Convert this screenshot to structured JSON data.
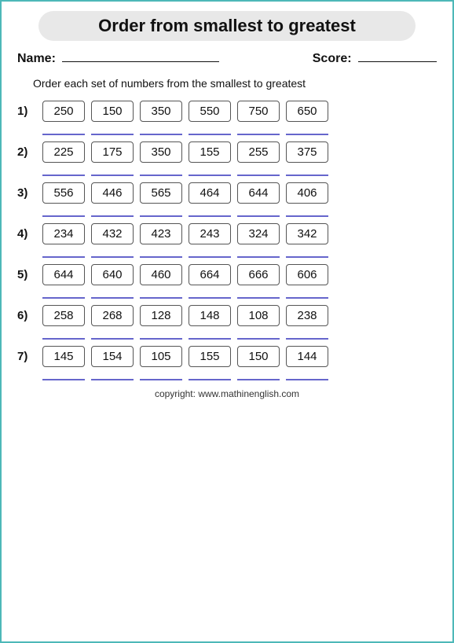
{
  "title": "Order from smallest to greatest",
  "name_label": "Name:",
  "score_label": "Score:",
  "instructions": "Order each set of numbers from the smallest to greatest",
  "problems": [
    {
      "num": "1)",
      "numbers": [
        "250",
        "150",
        "350",
        "550",
        "750",
        "650"
      ]
    },
    {
      "num": "2)",
      "numbers": [
        "225",
        "175",
        "350",
        "155",
        "255",
        "375"
      ]
    },
    {
      "num": "3)",
      "numbers": [
        "556",
        "446",
        "565",
        "464",
        "644",
        "406"
      ]
    },
    {
      "num": "4)",
      "numbers": [
        "234",
        "432",
        "423",
        "243",
        "324",
        "342"
      ]
    },
    {
      "num": "5)",
      "numbers": [
        "644",
        "640",
        "460",
        "664",
        "666",
        "606"
      ]
    },
    {
      "num": "6)",
      "numbers": [
        "258",
        "268",
        "128",
        "148",
        "108",
        "238"
      ]
    },
    {
      "num": "7)",
      "numbers": [
        "145",
        "154",
        "105",
        "155",
        "150",
        "144"
      ]
    }
  ],
  "copyright": "copyright:   www.mathinenglish.com"
}
